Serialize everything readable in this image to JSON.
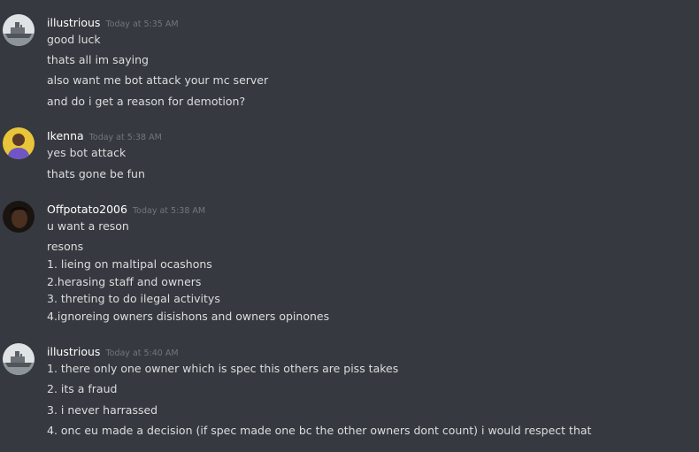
{
  "messages": [
    {
      "username": "illustrious",
      "timestamp": "Today at 5:35 AM",
      "avatar": "ship-avatar",
      "lines": [
        "good luck",
        "thats all im saying",
        "also want me bot attack your mc server",
        "and do i get a reason for demotion?"
      ]
    },
    {
      "username": "Ikenna",
      "timestamp": "Today at 5:38 AM",
      "avatar": "person-avatar",
      "lines": [
        "yes bot attack",
        "thats gone be fun"
      ]
    },
    {
      "username": "Offpotato2006",
      "timestamp": "Today at 5:38 AM",
      "avatar": "dark-face-avatar",
      "lines": [
        "u want a reson",
        "resons",
        "1. lieing on maltipal ocashons",
        "2.herasing staff and owners",
        "3. threting to do ilegal activitys",
        "4.ignoreing owners disishons and owners opinones"
      ]
    },
    {
      "username": "illustrious",
      "timestamp": "Today at 5:40 AM",
      "avatar": "ship-avatar",
      "lines": [
        "1. there only one owner which is spec this others are piss takes",
        "2. its a fraud",
        "3. i never harrassed",
        "4. onc eu made  a decision (if spec made one bc the other owners dont count) i would respect that"
      ]
    }
  ],
  "colors": {
    "background": "#36393f",
    "username": "#ffffff",
    "timestamp": "#72767d",
    "text": "#dcddde"
  }
}
